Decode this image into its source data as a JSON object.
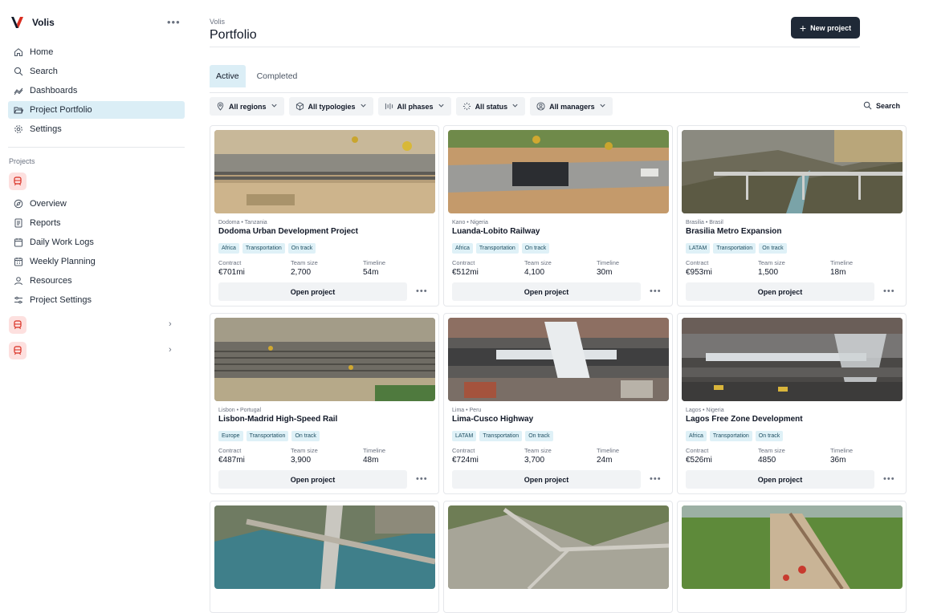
{
  "app": {
    "name": "Volis",
    "more_icon": "more-horizontal-icon"
  },
  "sidebar": {
    "items": [
      {
        "label": "Home",
        "icon": "home-icon"
      },
      {
        "label": "Search",
        "icon": "search-icon"
      },
      {
        "label": "Dashboards",
        "icon": "dashboards-icon"
      },
      {
        "label": "Project Portfolio",
        "icon": "folder-open-icon",
        "active": true
      },
      {
        "label": "Settings",
        "icon": "gear-icon"
      }
    ],
    "projects_label": "Projects",
    "project_items": [
      {
        "label": "Overview",
        "icon": "compass-icon"
      },
      {
        "label": "Reports",
        "icon": "report-icon"
      },
      {
        "label": "Daily Work Logs",
        "icon": "calendar-icon"
      },
      {
        "label": "Weekly Planning",
        "icon": "calendar-grid-icon"
      },
      {
        "label": "Resources",
        "icon": "users-icon"
      },
      {
        "label": "Project Settings",
        "icon": "sliders-icon"
      }
    ]
  },
  "header": {
    "breadcrumb": "Volis",
    "title": "Portfolio",
    "new_button": "New project"
  },
  "tabs": [
    {
      "label": "Active",
      "active": true
    },
    {
      "label": "Completed"
    }
  ],
  "filters": [
    {
      "label": "All regions",
      "icon": "location-pin-icon"
    },
    {
      "label": "All typologies",
      "icon": "cube-icon"
    },
    {
      "label": "All phases",
      "icon": "phases-icon"
    },
    {
      "label": "All status",
      "icon": "status-spinner-icon"
    },
    {
      "label": "All managers",
      "icon": "user-circle-icon"
    }
  ],
  "search_label": "Search",
  "meta_labels": {
    "contract": "Contract",
    "team": "Team size",
    "timeline": "Timeline"
  },
  "open_label": "Open project",
  "projects": [
    {
      "location": "Dodoma • Tanzania",
      "name": "Dodoma Urban Development Project",
      "tags": [
        "Africa",
        "Transportation",
        "On track"
      ],
      "contract": "€701mi",
      "team": "2,700",
      "timeline": "54m"
    },
    {
      "location": "Kano • Nigeria",
      "name": "Luanda-Lobito Railway",
      "tags": [
        "Africa",
        "Transportation",
        "On track"
      ],
      "contract": "€512mi",
      "team": "4,100",
      "timeline": "30m"
    },
    {
      "location": "Brasilia • Brasil",
      "name": "Brasilia Metro Expansion",
      "tags": [
        "LATAM",
        "Transportation",
        "On track"
      ],
      "contract": "€953mi",
      "team": "1,500",
      "timeline": "18m"
    },
    {
      "location": "Lisbon • Portugal",
      "name": "Lisbon-Madrid High-Speed Rail",
      "tags": [
        "Europe",
        "Transportation",
        "On track"
      ],
      "contract": "€487mi",
      "team": "3,900",
      "timeline": "48m"
    },
    {
      "location": "Lima • Peru",
      "name": "Lima-Cusco Highway",
      "tags": [
        "LATAM",
        "Transportation",
        "On track"
      ],
      "contract": "€724mi",
      "team": "3,700",
      "timeline": "24m"
    },
    {
      "location": "Lagos • Nigeria",
      "name": "Lagos Free Zone Development",
      "tags": [
        "Africa",
        "Transportation",
        "On track"
      ],
      "contract": "€526mi",
      "team": "4850",
      "timeline": "36m"
    }
  ]
}
